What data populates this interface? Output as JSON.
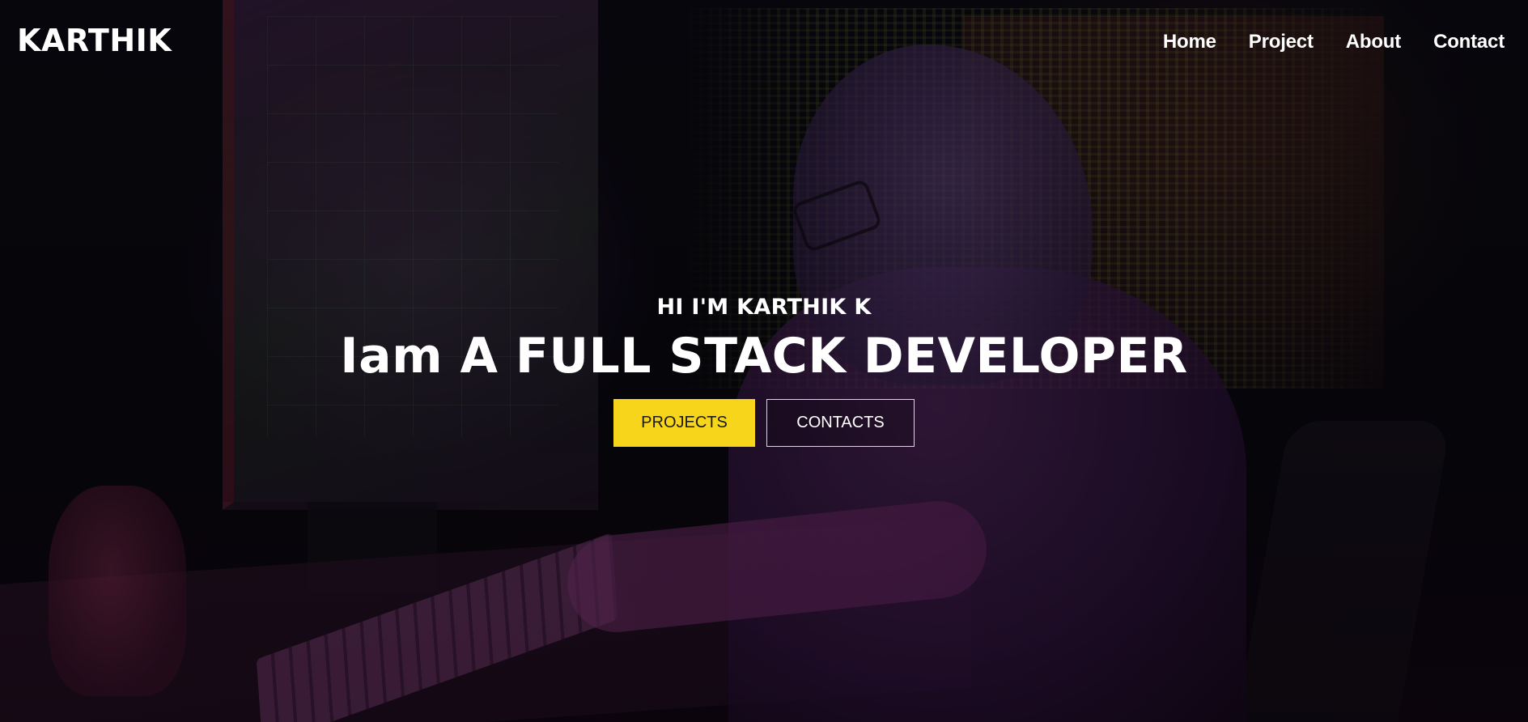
{
  "header": {
    "brand": "KARTHIK",
    "nav": [
      {
        "label": "Home"
      },
      {
        "label": "Project"
      },
      {
        "label": "About"
      },
      {
        "label": "Contact"
      }
    ]
  },
  "hero": {
    "greeting": "HI I'M KARTHIK K",
    "headline": "Iam A FULL STACK DEVELOPER",
    "buttons": {
      "primary_label": "PROJECTS",
      "secondary_label": "CONTACTS"
    },
    "background_image": "hacker-at-computer-illustration"
  },
  "colors": {
    "primary_button": "#f6d51a",
    "text": "#ffffff",
    "outline_border": "#d8d8d8"
  }
}
